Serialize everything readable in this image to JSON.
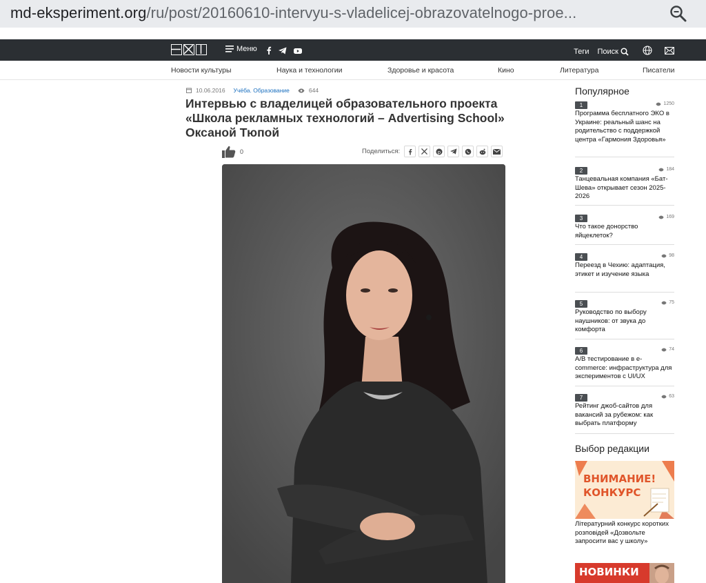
{
  "browser": {
    "url_host": "md-eksperiment.org",
    "url_path": "/ru/post/20160610-intervyu-s-vladelicej-obrazovatelnogo-proe..."
  },
  "topbar": {
    "menu_label": "Меню",
    "tags_label": "Теги",
    "search_label": "Поиск"
  },
  "nav": {
    "items": [
      "Новости культуры",
      "Наука и технологии",
      "Здоровье и красота",
      "Кино",
      "Литература",
      "Писатели"
    ]
  },
  "article": {
    "date": "10.06.2016",
    "category": "Учёба. Образование",
    "views": "644",
    "title": "Интервью с владелицей образовательного проекта «Школа рекламных технологий – Advertising School» Оксаной Тюпой",
    "likes": "0",
    "share_label": "Поделиться:"
  },
  "sidebar": {
    "popular_title": "Популярное",
    "popular": [
      {
        "num": "1",
        "views": "1250",
        "text": "Программа бесплатного ЭКО в Украине: реальный шанс на родительство с поддержкой центра «Гармония Здоровья»"
      },
      {
        "num": "2",
        "views": "184",
        "text": "Танцевальная компания «Бат-Шева» открывает сезон 2025-2026"
      },
      {
        "num": "3",
        "views": "169",
        "text": "Что такое донорство яйцеклеток?"
      },
      {
        "num": "4",
        "views": "98",
        "text": "Переезд в Чехию: адаптация, этикет и изучение языка"
      },
      {
        "num": "5",
        "views": "75",
        "text": "Руководство по выбору наушников: от звука до комфорта"
      },
      {
        "num": "6",
        "views": "74",
        "text": "A/B тестирование в e-commerce: инфраструктура для экспериментов с UI/UX"
      },
      {
        "num": "7",
        "views": "63",
        "text": "Рейтинг джоб-сайтов для вакансий за рубежом: как выбрать платформу"
      }
    ],
    "editors_title": "Выбор редакции",
    "editor_banner_1": "ВНИМАНИЕ! КОНКУРС",
    "editor_caption_1": "Літературний конкурс коротких розповідей «Дозвольте запросити вас у школу»",
    "editor_banner_2": "НОВИНКИ"
  },
  "colors": {
    "topbar_bg": "#2b2f33",
    "link_blue": "#1a6fbf",
    "banner_orange": "#e0552a"
  }
}
